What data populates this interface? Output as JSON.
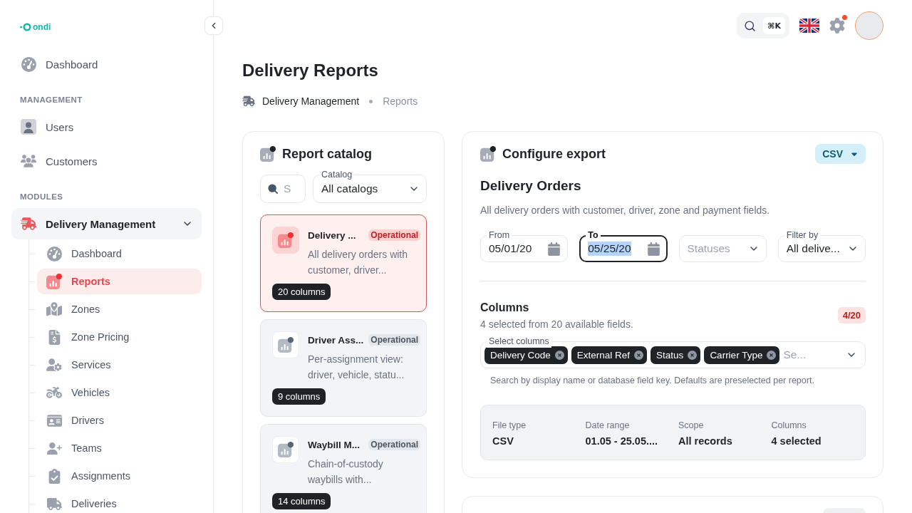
{
  "sidebar": {
    "logo": "ondi",
    "sections": [
      {
        "items": [
          {
            "label": "Dashboard",
            "selected": false
          }
        ]
      },
      {
        "heading": "MANAGEMENT",
        "items": [
          {
            "label": "Users",
            "selected": false
          },
          {
            "label": "Customers",
            "selected": false
          }
        ]
      },
      {
        "heading": "MODULES",
        "items": [
          {
            "label": "Delivery Management",
            "selected": false,
            "expanded": true,
            "children": [
              {
                "label": "Dashboard",
                "selected": false
              },
              {
                "label": "Reports",
                "selected": true
              },
              {
                "label": "Zones",
                "selected": false
              },
              {
                "label": "Zone Pricing",
                "selected": false
              },
              {
                "label": "Services",
                "selected": false
              },
              {
                "label": "Vehicles",
                "selected": false
              },
              {
                "label": "Drivers",
                "selected": false
              },
              {
                "label": "Teams",
                "selected": false
              },
              {
                "label": "Assignments",
                "selected": false
              },
              {
                "label": "Deliveries",
                "selected": false
              }
            ]
          }
        ]
      }
    ]
  },
  "header": {
    "search_shortcut": "⌘K",
    "settings_alert": true
  },
  "page": {
    "title": "Delivery Reports",
    "breadcrumbs": [
      {
        "label": "Delivery Management",
        "current": false
      },
      {
        "label": "Reports",
        "current": true
      }
    ]
  },
  "catalog": {
    "title": "Report catalog",
    "search": {
      "placeholder": "S"
    },
    "catalog_select": {
      "label": "Catalog",
      "value": "All catalogs"
    },
    "reports": [
      {
        "title": "Delivery ...",
        "badge": "Operational",
        "description": "All delivery orders with customer, driver...",
        "columns": "20 columns",
        "selected": true
      },
      {
        "title": "Driver Ass...",
        "badge": "Operational",
        "description": "Per-assignment view: driver, vehicle, statu...",
        "columns": "9 columns",
        "selected": false
      },
      {
        "title": "Waybill M...",
        "badge": "Operational",
        "description": "Chain-of-custody waybills with...",
        "columns": "14 columns",
        "selected": false
      }
    ]
  },
  "export": {
    "title": "Configure export",
    "format": "CSV",
    "report_title": "Delivery Orders",
    "report_description": "All delivery orders with customer, driver, zone and payment fields.",
    "filters": [
      {
        "kind": "date",
        "label": "From",
        "value": "05/01/20",
        "focused": false
      },
      {
        "kind": "date",
        "label": "To",
        "value": "05/25/20",
        "focused": true
      },
      {
        "kind": "select",
        "placeholder": "Statuses",
        "focused": false
      },
      {
        "kind": "select",
        "label": "Filter by",
        "value": "All delive...",
        "focused": false
      }
    ],
    "columns": {
      "title": "Columns",
      "subtitle": "4 selected from 20 available fields.",
      "count": "4/20",
      "select_label": "Select columns",
      "chips": [
        "Delivery Code",
        "External Ref",
        "Status",
        "Carrier Type"
      ],
      "placeholder": "Se...",
      "hint": "Search by display name or database field key. Defaults are preselected per report."
    },
    "summary": [
      {
        "label": "File type",
        "value": "CSV"
      },
      {
        "label": "Date range",
        "value": "01.05 - 25.05...."
      },
      {
        "label": "Scope",
        "value": "All records"
      },
      {
        "label": "Columns",
        "value": "4 selected"
      }
    ]
  }
}
